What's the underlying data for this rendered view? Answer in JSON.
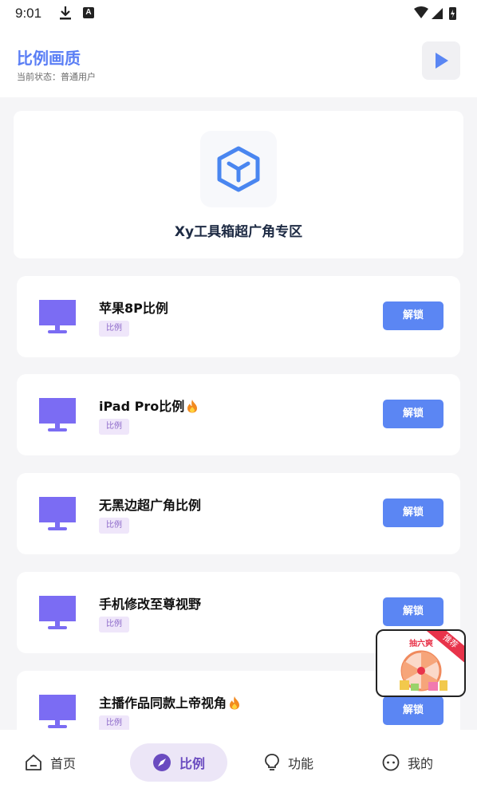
{
  "status_bar": {
    "time": "9:01",
    "a_badge": "A"
  },
  "header": {
    "title": "比例画质",
    "subtitle": "当前状态：普通用户"
  },
  "hero": {
    "title": "Xy工具箱超广角专区"
  },
  "items": [
    {
      "title": "苹果8P比例",
      "hot": false,
      "tag": "比例",
      "button": "解锁"
    },
    {
      "title": "iPad Pro比例",
      "hot": true,
      "tag": "比例",
      "button": "解锁"
    },
    {
      "title": "无黑边超广角比例",
      "hot": false,
      "tag": "比例",
      "button": "解锁"
    },
    {
      "title": "手机修改至尊视野",
      "hot": false,
      "tag": "比例",
      "button": "解锁"
    },
    {
      "title": "主播作品同款上帝视角",
      "hot": true,
      "tag": "比例",
      "button": "解锁"
    }
  ],
  "float_ad": {
    "badge": "推荐",
    "label": "抽六爽"
  },
  "nav": {
    "home": "首页",
    "ratio": "比例",
    "func": "功能",
    "me": "我的",
    "active": "ratio"
  },
  "colors": {
    "accent": "#5a7ef5",
    "button": "#5b86f3",
    "monitor": "#7b6cf3",
    "tag_bg": "#efe6fa",
    "nav_active_bg": "#ece6f7"
  }
}
